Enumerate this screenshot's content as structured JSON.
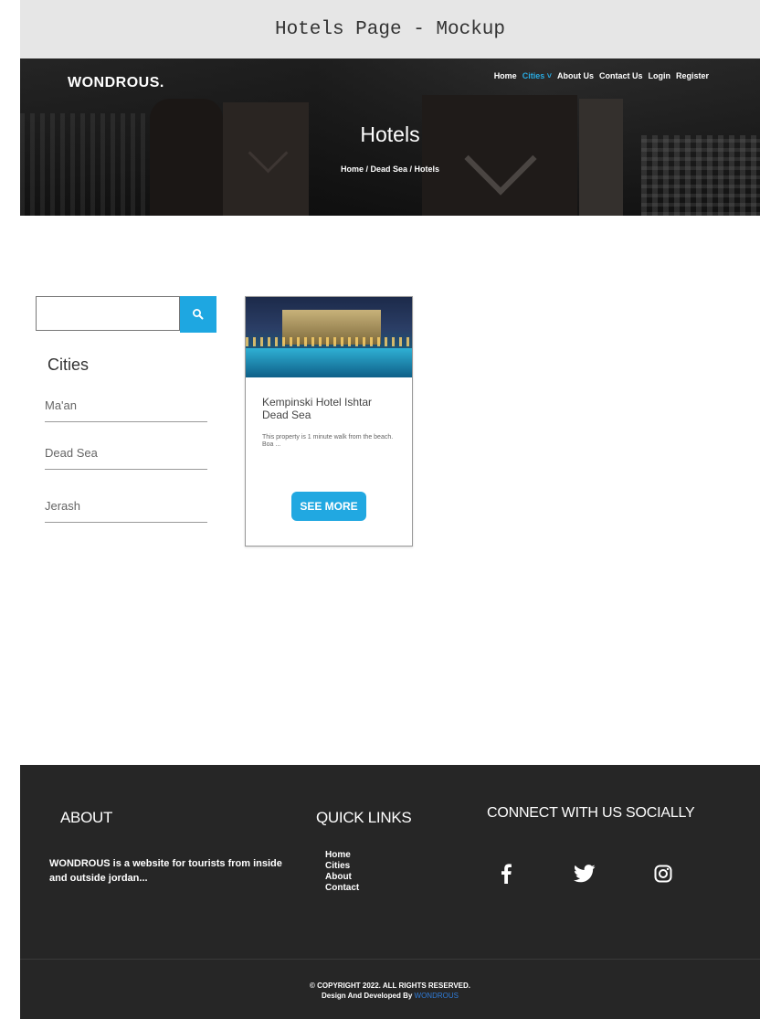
{
  "mockup": {
    "title": "Hotels Page - Mockup"
  },
  "header": {
    "logo": "WONDROUS.",
    "nav": [
      {
        "label": "Home"
      },
      {
        "label": "Cities ˅"
      },
      {
        "label": "About Us"
      },
      {
        "label": "Contact Us"
      },
      {
        "label": "Login"
      },
      {
        "label": "Register"
      }
    ],
    "hero_title": "Hotels",
    "breadcrumb": "Home / Dead Sea / Hotels"
  },
  "sidebar": {
    "search_placeholder": "",
    "cities_title": "Cities",
    "cities": [
      {
        "label": "Ma'an"
      },
      {
        "label": "Dead Sea"
      },
      {
        "label": "Jerash"
      }
    ]
  },
  "card": {
    "title": "Kempinski Hotel Ishtar Dead Sea",
    "description": "This property is 1 minute walk from the beach. Boa ...",
    "button": "SEE MORE"
  },
  "footer": {
    "about_title": "ABOUT",
    "about_text": "WONDROUS is a website for tourists from inside and outside jordan...",
    "quick_title": "QUICK LINKS",
    "links": [
      {
        "label": "Home"
      },
      {
        "label": "Cities"
      },
      {
        "label": "About"
      },
      {
        "label": "Contact"
      }
    ],
    "social_title": "CONNECT WITH US SOCIALLY",
    "social_icons": [
      "facebook-icon",
      "twitter-icon",
      "instagram-icon"
    ],
    "copyright": "© COPYRIGHT 2022. ALL RIGHTS RESERVED.",
    "design_by": "Design And Developed By",
    "brand": "WONDROUS"
  },
  "colors": {
    "accent": "#1ea7e1",
    "footer_bg": "#262626"
  }
}
